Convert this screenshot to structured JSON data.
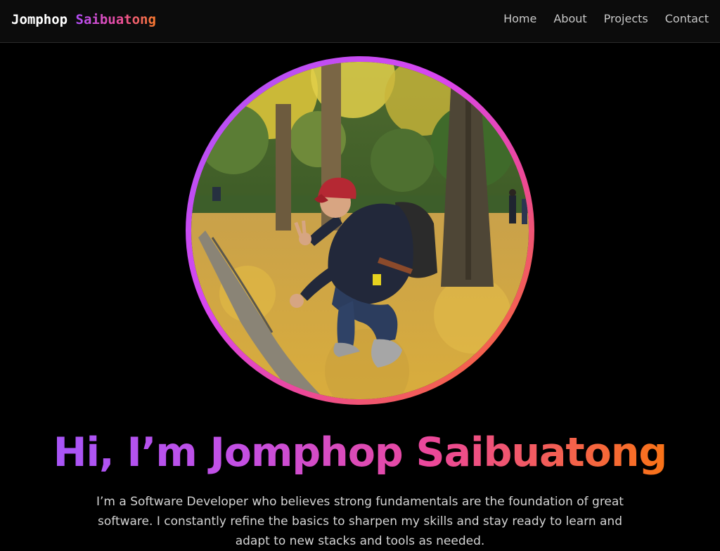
{
  "brand": {
    "first_name": "Jomphop",
    "last_name": "Saibuatong"
  },
  "nav": {
    "items": [
      {
        "label": "Home"
      },
      {
        "label": "About"
      },
      {
        "label": "Projects"
      },
      {
        "label": "Contact"
      }
    ]
  },
  "hero": {
    "headline": "Hi, I’m Jomphop Saibuatong",
    "bio": "I’m a Software Developer who believes strong fundamentals are the foundation of great software. I constantly refine the basics to sharpen my skills and stay ready to learn and adapt to new stacks and tools as needed."
  },
  "colors": {
    "background": "#000000",
    "gradient_start": "#a855f7",
    "gradient_mid": "#ec4899",
    "gradient_end": "#f97316"
  }
}
